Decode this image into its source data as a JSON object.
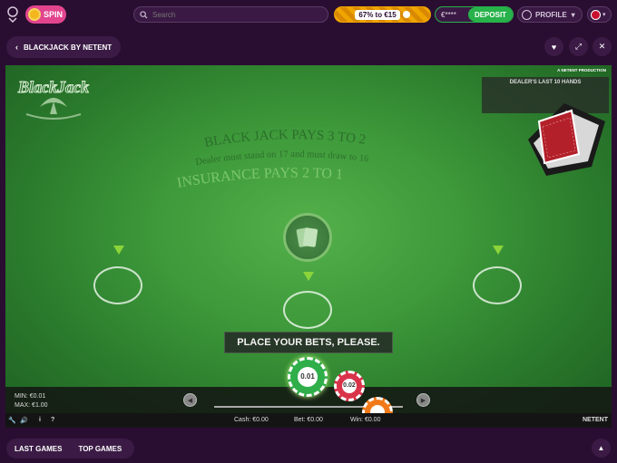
{
  "header": {
    "spin_label": "SPIN",
    "search_placeholder": "Search",
    "progress_text": "67% to €15",
    "progress": 0.67,
    "wallet_balance": "€****",
    "deposit_label": "DEPOSIT",
    "profile_label": "PROFILE",
    "colors": {
      "bg": "#2a0e31",
      "spin": "#e2458e",
      "progress": "#f0a400",
      "deposit": "#27b24a"
    }
  },
  "subbar": {
    "back_label": "BLACKJACK BY NETENT",
    "favorite_icon": "heart-icon",
    "fullscreen_icon": "expand-icon",
    "close_icon": "close-icon"
  },
  "game": {
    "logo_text": "BlackJack",
    "production_label": "A NETENT PRODUCTION",
    "dealer_hands_label": "DEALER'S LAST 10 HANDS",
    "table_text": {
      "line1": "BLACK JACK PAYS 3 TO 2",
      "line2": "Dealer must stand on 17 and must draw to 16",
      "line3": "INSURANCE PAYS 2 TO 1"
    },
    "prompt": "PLACE YOUR BETS, PLEASE.",
    "min_label": "MIN: €0.01",
    "max_label": "MAX: €1.00",
    "chips": [
      {
        "value": "0.01",
        "color": "#2fae4a"
      },
      {
        "value": "0.02",
        "color": "#d9334a"
      },
      {
        "value": "",
        "color": "#f07a1a"
      }
    ],
    "cash_label": "Cash: €0.00",
    "bet_label": "Bet: €0.00",
    "win_label": "Win: €0.00",
    "brand": "NETENT",
    "info_label": "i",
    "help_label": "?"
  },
  "footer": {
    "last_games": "LAST GAMES",
    "top_games": "TOP GAMES"
  }
}
